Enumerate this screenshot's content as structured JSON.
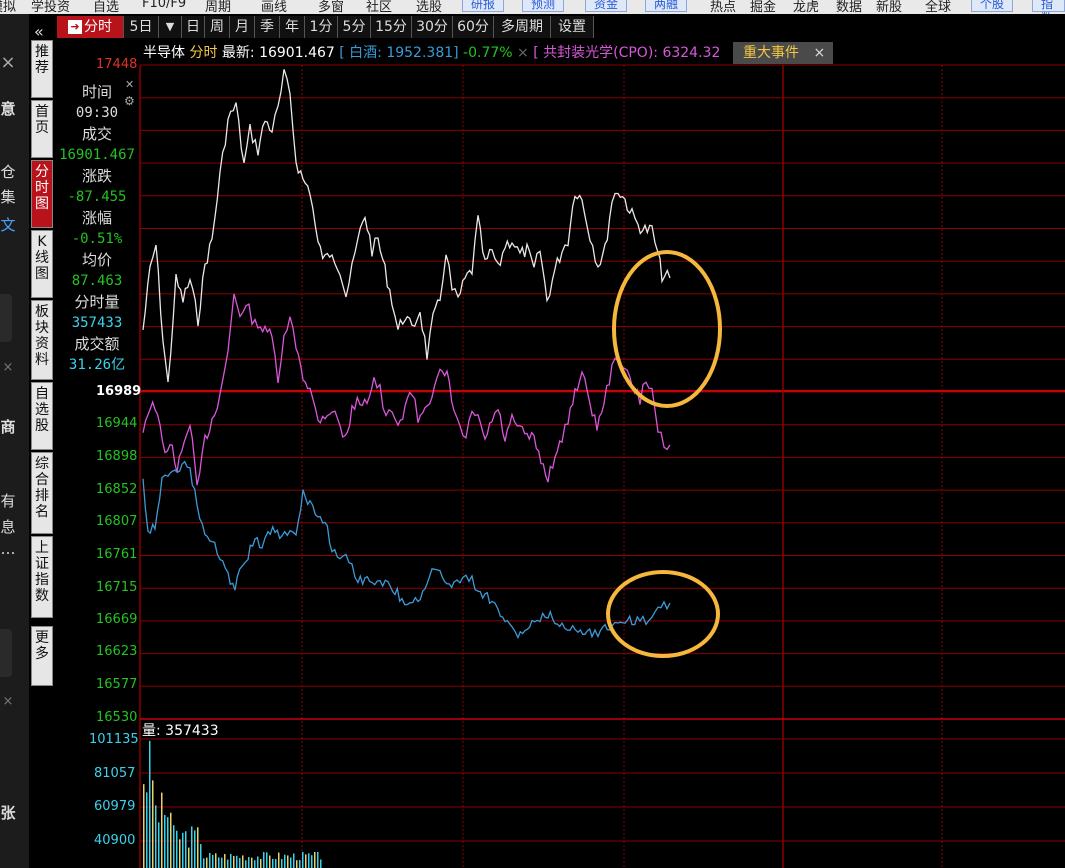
{
  "top_menu": {
    "items": [
      "模拟",
      "学投资",
      "自选",
      "F10/F9",
      "周期",
      "画线",
      "多窗",
      "社区",
      "选股"
    ],
    "buttons": [
      "研报",
      "预测",
      "资金",
      "两融"
    ],
    "items2": [
      "热点",
      "掘金",
      "龙虎",
      "数据",
      "新股",
      "全球"
    ],
    "buttons2": [
      "个股",
      "指数"
    ]
  },
  "left_panel": {
    "glyphs": [
      "×",
      "意",
      "仓",
      "集",
      "文",
      "×",
      "商",
      "有",
      "息",
      "…",
      "×",
      "张"
    ]
  },
  "vertical_tabs": [
    {
      "label": "推荐",
      "active": false
    },
    {
      "label": "首页",
      "active": false
    },
    {
      "label": "分时图",
      "active": true
    },
    {
      "label": "K线图",
      "active": false
    },
    {
      "label": "板块资料",
      "active": false
    },
    {
      "label": "自选股",
      "active": false
    },
    {
      "label": "综合排名",
      "active": false
    },
    {
      "label": "上证指数",
      "active": false
    },
    {
      "label": "更多",
      "active": false
    }
  ],
  "tabbar": {
    "items": [
      "分时",
      "5日",
      "▼",
      "日",
      "周",
      "月",
      "季",
      "年",
      "1分",
      "5分",
      "15分",
      "30分",
      "60分",
      "多周期",
      "设置"
    ],
    "active": "分时"
  },
  "header": {
    "name": "半导体",
    "mode": "分时",
    "latest_label": "最新:",
    "latest_value": "16901.467",
    "compare1": "[ 白酒: 1952.381]",
    "compare1_change": "-0.77%",
    "compare2": "[ 共封装光学(CPO): 6324.32",
    "event_label": "重大事件",
    "event_close": "×"
  },
  "info_box": {
    "time_label": "时间",
    "time_value": "09:30",
    "deal_label": "成交",
    "deal_value": "16901.467",
    "change_label": "涨跌",
    "change_value": "-87.455",
    "pct_label": "涨幅",
    "pct_value": "-0.51%",
    "avg_label": "均价",
    "avg_value": "87.463",
    "vol_label": "分时量",
    "vol_value": "357433",
    "amount_label": "成交额",
    "amount_value": "31.26亿"
  },
  "price_axis": {
    "labels": [
      "17448",
      "16989",
      "16944",
      "16898",
      "16852",
      "16807",
      "16761",
      "16715",
      "16669",
      "16623",
      "16577",
      "16530"
    ]
  },
  "volume_panel": {
    "title": "量: 357433",
    "labels": [
      "101135",
      "81057",
      "60979",
      "40900"
    ]
  },
  "colors": {
    "grid": "#8b0000",
    "mid_line": "#c8000d",
    "white_line": "#e8e8e8",
    "magenta_line": "#d957d9",
    "blue_line": "#3b9bd8",
    "circle": "#f5b73c",
    "rise": "#e0322a",
    "fall": "#22c322",
    "cyan": "#3ad3ee"
  }
}
